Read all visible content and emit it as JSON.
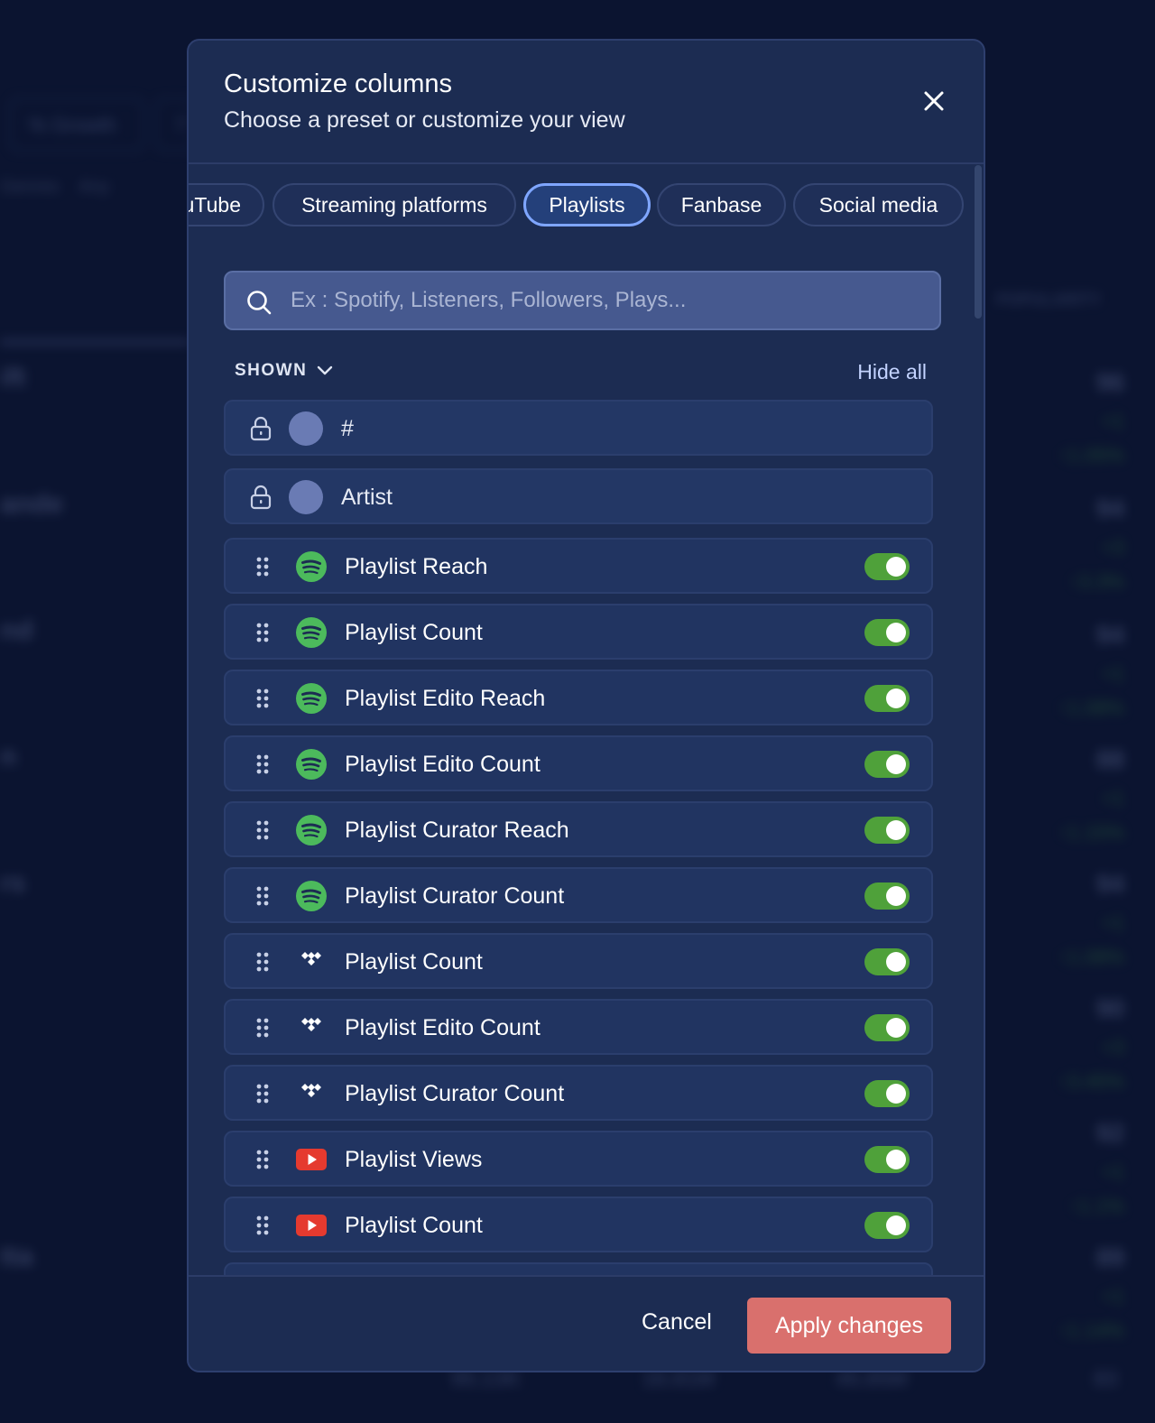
{
  "background": {
    "chips": [
      "% Growth",
      "7",
      "Genres",
      "Any"
    ],
    "left_names": [
      "ift",
      "ande",
      "nd",
      "n",
      "rs",
      "tta"
    ],
    "right_header": "POPULARITY",
    "right_scores": [
      {
        "score": "96",
        "delta": "+1",
        "pct": "↑1.05%"
      },
      {
        "score": "94",
        "delta": "+3",
        "pct": "↑3.3%"
      },
      {
        "score": "94",
        "delta": "+1",
        "pct": "↑1.08%"
      },
      {
        "score": "88",
        "delta": "+1",
        "pct": "↑1.15%"
      },
      {
        "score": "94",
        "delta": "+1",
        "pct": "↑1.08%"
      },
      {
        "score": "90",
        "delta": "+3",
        "pct": "↑3.45%"
      },
      {
        "score": "92",
        "delta": "+1",
        "pct": "↑1.1%"
      },
      {
        "score": "89",
        "delta": "+1",
        "pct": "↑1.14%"
      }
    ],
    "bottom_values": [
      "95.13K",
      "16.81M",
      "45.85M",
      "83"
    ]
  },
  "modal": {
    "title": "Customize columns",
    "subtitle": "Choose a preset or customize your view",
    "tabs": [
      {
        "label": "uTube"
      },
      {
        "label": "Streaming platforms"
      },
      {
        "label": "Playlists"
      },
      {
        "label": "Fanbase"
      },
      {
        "label": "Social media"
      }
    ],
    "active_tab": "Playlists",
    "search": {
      "placeholder": "Ex : Spotify, Listeners, Followers, Plays..."
    },
    "section": {
      "label": "SHOWN",
      "hide_all": "Hide all"
    },
    "locked_rows": [
      {
        "label": "#"
      },
      {
        "label": "Artist"
      }
    ],
    "rows": [
      {
        "label": "Playlist Reach",
        "platform": "spotify-icon",
        "enabled": true
      },
      {
        "label": "Playlist Count",
        "platform": "spotify-icon",
        "enabled": true
      },
      {
        "label": "Playlist Edito Reach",
        "platform": "spotify-icon",
        "enabled": true
      },
      {
        "label": "Playlist Edito Count",
        "platform": "spotify-icon",
        "enabled": true
      },
      {
        "label": "Playlist Curator Reach",
        "platform": "spotify-icon",
        "enabled": true
      },
      {
        "label": "Playlist Curator Count",
        "platform": "spotify-icon",
        "enabled": true
      },
      {
        "label": "Playlist Count",
        "platform": "tidal-icon",
        "enabled": true
      },
      {
        "label": "Playlist Edito Count",
        "platform": "tidal-icon",
        "enabled": true
      },
      {
        "label": "Playlist Curator Count",
        "platform": "tidal-icon",
        "enabled": true
      },
      {
        "label": "Playlist Views",
        "platform": "youtube-icon",
        "enabled": true
      },
      {
        "label": "Playlist Count",
        "platform": "youtube-icon",
        "enabled": true
      }
    ],
    "footer": {
      "cancel": "Cancel",
      "apply": "Apply changes"
    }
  },
  "colors": {
    "modal_bg": "#1c2c52",
    "toggle_on": "#4fa13a",
    "apply": "#d9706d",
    "spotify": "#4cba5c",
    "youtube": "#e53a2f"
  }
}
